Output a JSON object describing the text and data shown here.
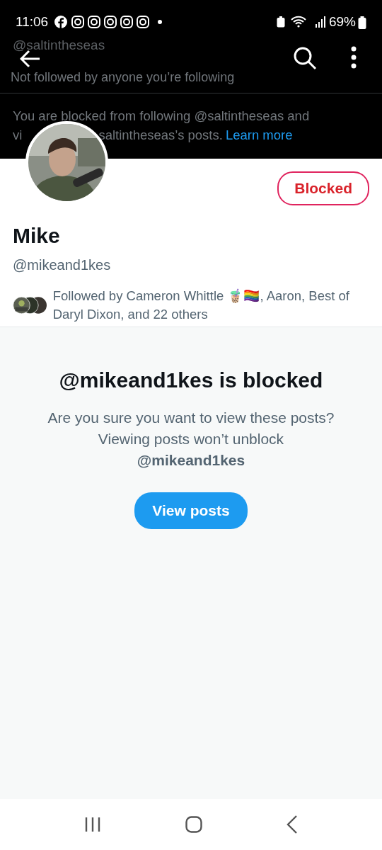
{
  "status_bar": {
    "time": "11:06",
    "battery": "69%"
  },
  "header": {
    "handle": "@saltintheseas",
    "subtitle": "Not followed by anyone you’re following"
  },
  "notice": {
    "line_1": "You are blocked from following @saltintheseas and",
    "line_2_start": "vi",
    "line_2_rest": "saltintheseas’s posts.",
    "link": "Learn more"
  },
  "profile": {
    "name": "Mike",
    "handle": "@mikeand1kes",
    "button": "Blocked",
    "followed_by": "Followed by Cameron Whittle 🧋🏳️‍🌈, Aaron, Best of Daryl Dixon, and 22 others"
  },
  "blocked_panel": {
    "title": "@mikeand1kes is blocked",
    "message": "Are you sure you want to view these posts? Viewing posts won’t unblock **@mikeand1kes**",
    "button": "View posts"
  }
}
